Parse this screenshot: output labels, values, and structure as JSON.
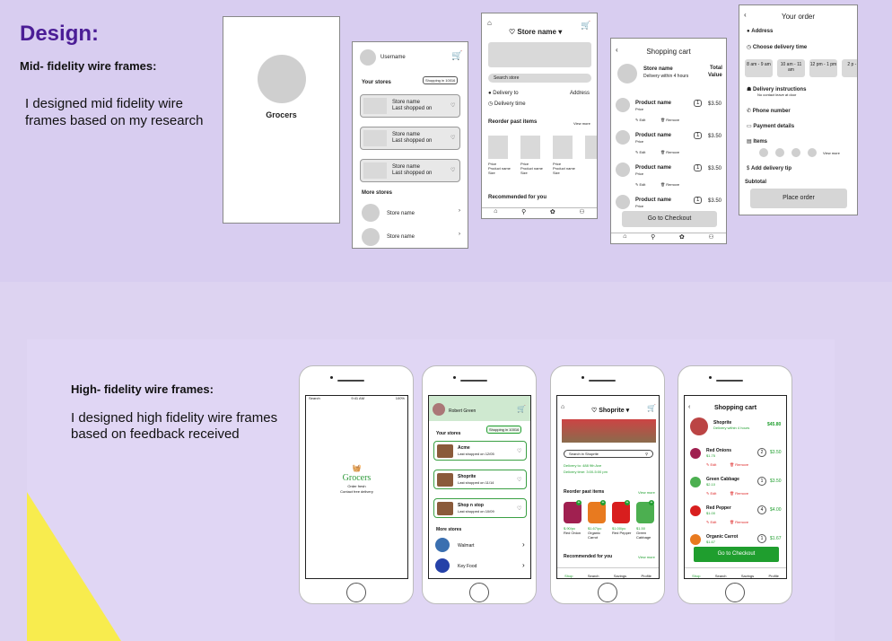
{
  "heading": "Design:",
  "mid": {
    "title": "Mid- fidelity wire frames:",
    "desc": "I designed mid fidelity wire frames based on my research"
  },
  "high": {
    "title": "High- fidelity wire frames:",
    "desc": "I designed high fidelity wire frames based on feedback received"
  },
  "wf1": {
    "logo": "Grocers"
  },
  "wf2": {
    "username": "Username",
    "badge": "Shopping in 10016",
    "your_stores": "Your stores",
    "store_name": "Store name",
    "last": "Last shopped on",
    "more_stores": "More stores"
  },
  "wf3": {
    "store": "Store name",
    "search": "Search store",
    "delivery_to": "Delivery to",
    "address": "Address",
    "delivery_time": "Delivery time",
    "reorder": "Reorder past items",
    "view_more": "View more",
    "price": "Price",
    "product_name": "Product name",
    "size": "Size",
    "recommended": "Recommended for you"
  },
  "wf4": {
    "title": "Shopping cart",
    "store": "Store name",
    "delivery": "Delivery within 4 hours",
    "total": "Total",
    "value": "Value",
    "product": "Product name",
    "price": "Price",
    "qty": "1",
    "amount": "$3.50",
    "edit": "Edit",
    "remove": "Remove",
    "checkout": "Go to Checkout"
  },
  "wf5": {
    "title": "Your order",
    "address": "Address",
    "choose_time": "Choose delivery time",
    "slots": [
      "8 am - 9 am",
      "10 am - 11 am",
      "12 pm - 1 pm",
      "2 p - 3 p"
    ],
    "instructions": "Delivery instructions",
    "no_contact": "No contact leave at door",
    "phone": "Phone number",
    "payment": "Payment details",
    "items": "Items",
    "view_more": "View more",
    "tip": "Add delivery tip",
    "subtotal": "Subtotal",
    "place": "Place order"
  },
  "hf1": {
    "logo": "Grocers",
    "tag1": "Order fresh",
    "tag2": "Contact free delivery",
    "status_left": "Search",
    "status_mid": "9:41 AM",
    "status_right": "100%"
  },
  "hf2": {
    "user": "Robert Green",
    "badge": "Shopping in 10016",
    "your_stores": "Your stores",
    "stores": [
      {
        "name": "Acme",
        "last": "Last shopped on 12/05"
      },
      {
        "name": "Shoprite",
        "last": "Last shopped on 11/14"
      },
      {
        "name": "Shop n stop",
        "last": "Last shopped on 10/09"
      }
    ],
    "more": "More stores",
    "more_stores": [
      "Walmart",
      "Key Food"
    ]
  },
  "hf3": {
    "store": "Shoprite",
    "search": "Search in Shoprite",
    "delivery": "Delivery to: 488 9th Ave",
    "time": "Delivery time: 3:00-5:00 pm",
    "reorder": "Reorder past items",
    "view_more": "View more",
    "items": [
      {
        "price": "$.90/pc",
        "name": "Red Onion"
      },
      {
        "price": "$1.67/pc",
        "name": "Organic Carrot"
      },
      {
        "price": "$1.00/pc",
        "name": "Red Pepper"
      },
      {
        "price": "$1.50",
        "name": "Green Cabbage"
      }
    ],
    "recommended": "Recommended for you",
    "nav": [
      "Shop",
      "Search",
      "Savings",
      "Profile"
    ]
  },
  "hf4": {
    "title": "Shopping cart",
    "store": "Shoprite",
    "delivery": "Delivery within 4 hours",
    "total": "$45.80",
    "items": [
      {
        "name": "Red Onions",
        "price": "$1.75",
        "qty": "2",
        "amt": "$3.50"
      },
      {
        "name": "Green Cabbage",
        "price": "$2.10",
        "qty": "1",
        "amt": "$3.50"
      },
      {
        "name": "Red Pepper",
        "price": "$1.00",
        "qty": "4",
        "amt": "$4.00"
      },
      {
        "name": "Organic Carrot",
        "price": "$1.67",
        "qty": "1",
        "amt": "$1.67"
      }
    ],
    "edit": "Edit",
    "remove": "Remove",
    "checkout": "Go to Checkout"
  }
}
